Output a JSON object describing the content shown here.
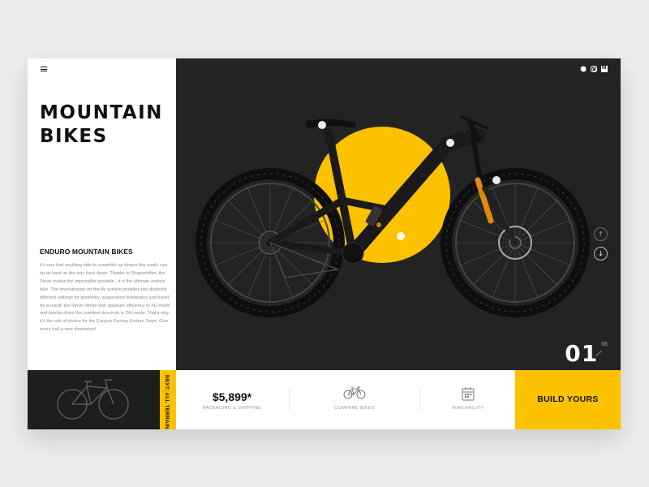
{
  "brand": {
    "accent": "#fcc200",
    "dark": "#232323"
  },
  "header": {
    "title_line1": "MOUNTAIN",
    "title_line2": "BIKES",
    "social": [
      "twitter-icon",
      "instagram-icon",
      "medium-icon"
    ]
  },
  "product": {
    "subtitle": "ENDURO MOUNTAIN BIKES",
    "description": "It's rare that anything able to scramble up slopes this easily can rip as hard on the way back down. Thanks to Shapeshifter, the Strive makes the impossible possible - it is the ultimate enduro bike. The revolutionary on-the-fly system provides two distinctly different settings for geometry, suspension kinematics and travel. As a result, the Strive climbs with absolute efficiency in XC mode and bombs down the rowdiest descents in DH mode. That's why it's the ride of choice for the Canyon Factory Enduro Team. Give every trail a new dimension!"
  },
  "slider": {
    "current": "01",
    "total": "06",
    "up_icon": "arrow-up-icon",
    "down_icon": "arrow-down-icon"
  },
  "bottom": {
    "next_label": "NEXT: ALL TERRAIN",
    "price": "$5,899*",
    "price_sub": "PACKAGING & SHIPPING",
    "compare_label": "COMPARE BIKES",
    "availability_label": "AVAILABILITY",
    "build_label": "BUILD YOURS"
  }
}
